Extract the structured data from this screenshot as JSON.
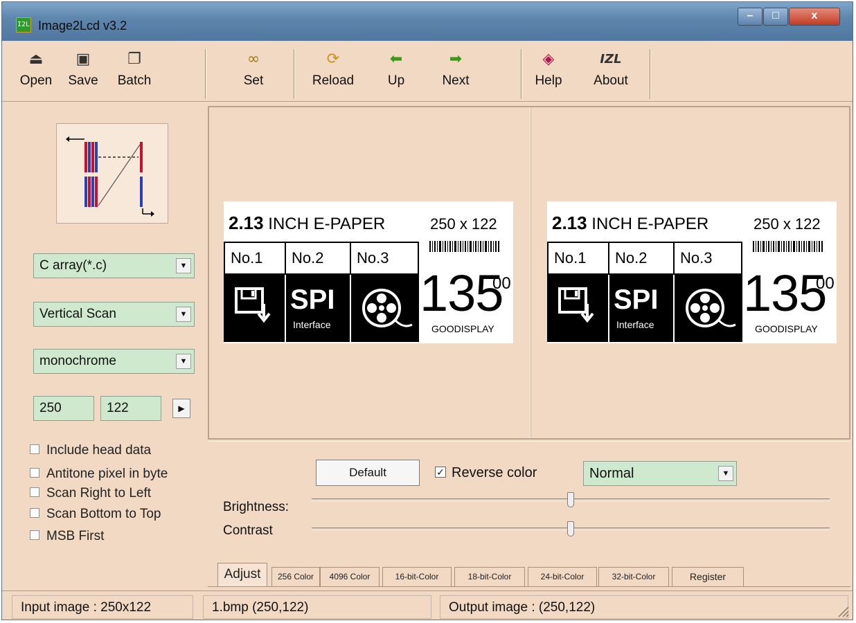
{
  "window": {
    "title": "Image2Lcd v3.2",
    "icon_text": "I2L"
  },
  "toolbar": {
    "items": [
      {
        "label": "Open",
        "icon": "open-icon"
      },
      {
        "label": "Save",
        "icon": "save-icon"
      },
      {
        "label": "Batch",
        "icon": "batch-icon"
      },
      {
        "label": "Set",
        "icon": "glasses-icon"
      },
      {
        "label": "Reload",
        "icon": "reload-icon"
      },
      {
        "label": "Up",
        "icon": "arrow-left-icon"
      },
      {
        "label": "Next",
        "icon": "arrow-right-icon"
      },
      {
        "label": "Help",
        "icon": "help-icon"
      },
      {
        "label": "About",
        "icon": "about-icon",
        "glyph": "IZL"
      }
    ]
  },
  "left_panel": {
    "output_type": "C array(*.c)",
    "scan_mode": "Vertical Scan",
    "gray_mode": "monochrome",
    "width": "250",
    "height": "122",
    "checkboxes": [
      {
        "label": "Include head data",
        "checked": false
      },
      {
        "label": "Antitone pixel in byte",
        "checked": false
      },
      {
        "label": "Scan Right to Left",
        "checked": false
      },
      {
        "label": "Scan Bottom to Top",
        "checked": false
      },
      {
        "label": "MSB First",
        "checked": false
      }
    ]
  },
  "epaper": {
    "title_bold": "2.13",
    "title_rest": " INCH E-PAPER",
    "resolution": "250 x 122",
    "cells": [
      "No.1",
      "No.2",
      "No.3"
    ],
    "spi": "SPI",
    "interface": "Interface",
    "price": "135",
    "price_sup": "00",
    "brand": "GOODISPLAY"
  },
  "adjust": {
    "default_label": "Default",
    "reverse_label": "Reverse color",
    "reverse_checked": true,
    "mode": "Normal",
    "brightness_label": "Brightness:",
    "contrast_label": "Contrast",
    "brightness": 0.5,
    "contrast": 0.5
  },
  "tabs": [
    "Adjust",
    "256 Color",
    "4096 Color",
    "16-bit-Color",
    "18-bit-Color",
    "24-bit-Color",
    "32-bit-Color",
    "Register"
  ],
  "status": {
    "input": "Input image : 250x122",
    "file": "1.bmp (250,122)",
    "output": "Output image : (250,122)"
  }
}
